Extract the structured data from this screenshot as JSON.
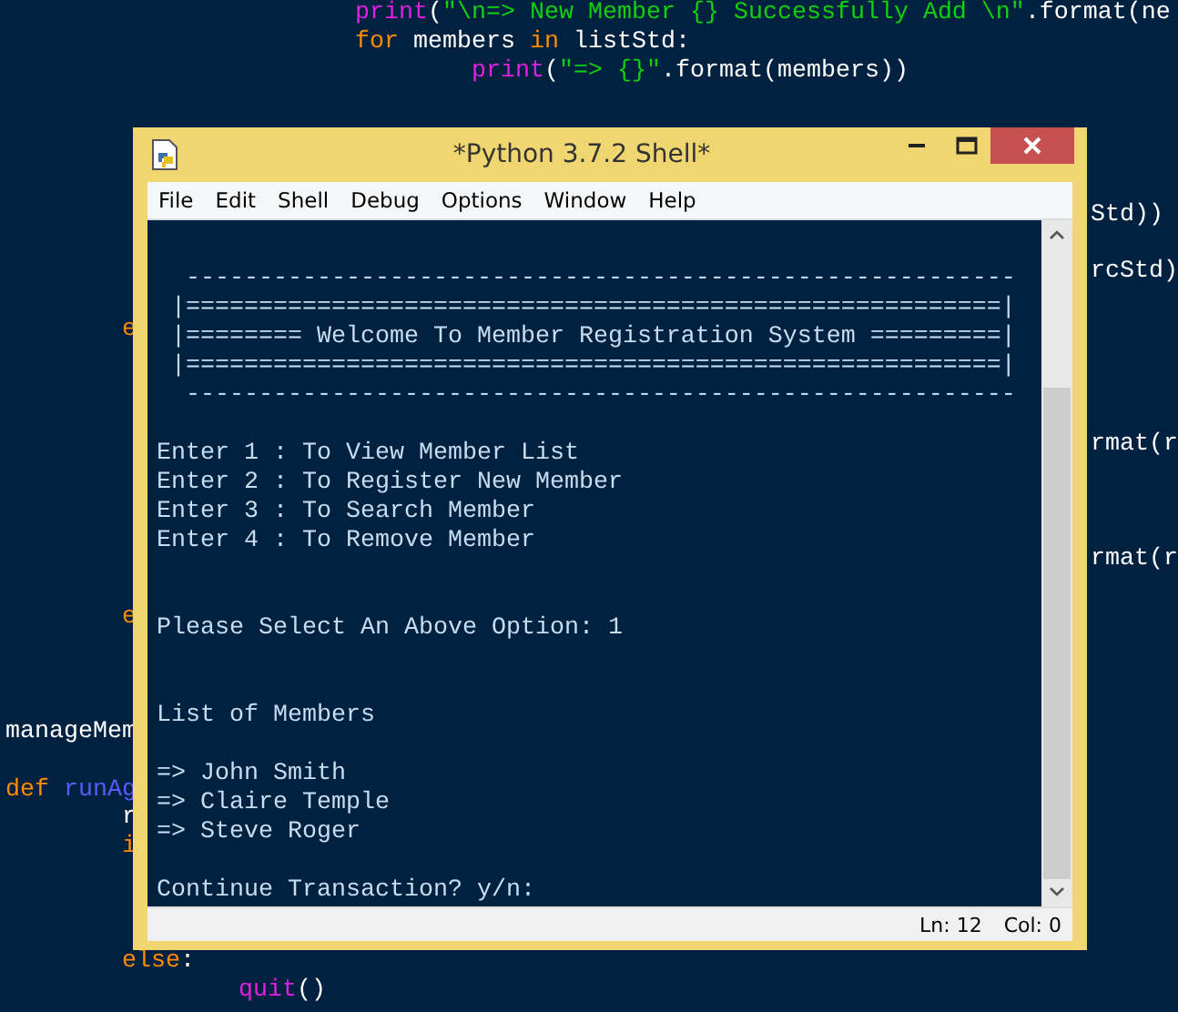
{
  "editor": {
    "lines": [
      {
        "children": [
          {
            "children": [
              {
                "children": [
                  {
                    "kind": "code",
                    "tokens": [
                      {
                        "kind": "builtin",
                        "text": "print"
                      },
                      {
                        "kind": "plain",
                        "text": "("
                      },
                      {
                        "kind": "string",
                        "text": "\"\\n=> New Member {} Successfully Add \\n\""
                      },
                      {
                        "kind": "plain",
                        "text": ".format(ne"
                      }
                    ]
                  },
                  {
                    "kind": "code",
                    "tokens": [
                      {
                        "kind": "keyword",
                        "text": "for"
                      },
                      {
                        "kind": "plain",
                        "text": " members "
                      },
                      {
                        "kind": "keyword",
                        "text": "in"
                      },
                      {
                        "kind": "plain",
                        "text": " listStd:"
                      }
                    ],
                    "children": [
                      {
                        "kind": "code",
                        "tokens": [
                          {
                            "kind": "builtin",
                            "text": "print"
                          },
                          {
                            "kind": "plain",
                            "text": "("
                          },
                          {
                            "kind": "string",
                            "text": "\"=> {}\""
                          },
                          {
                            "kind": "plain",
                            "text": ".format(members))"
                          }
                        ]
                      }
                    ]
                  }
                ]
              }
            ]
          }
        ]
      },
      {
        "kind": "blank"
      },
      {
        "kind": "blank"
      },
      {
        "kind": "blank"
      },
      {
        "kind": "blank"
      },
      {
        "kind": "tail",
        "tokens": [
          {
            "kind": "plain",
            "text": "Std))"
          }
        ]
      },
      {
        "kind": "blank"
      },
      {
        "kind": "tail",
        "tokens": [
          {
            "kind": "plain",
            "text": "rcStd)"
          }
        ]
      },
      {
        "kind": "blank"
      },
      {
        "children": [
          {
            "kind": "code",
            "tokens": [
              {
                "kind": "keyword",
                "text": "e"
              }
            ]
          }
        ]
      },
      {
        "kind": "blank"
      },
      {
        "kind": "blank"
      },
      {
        "kind": "blank"
      },
      {
        "kind": "tail",
        "tokens": [
          {
            "kind": "plain",
            "text": "rmat(r"
          }
        ]
      },
      {
        "kind": "blank"
      },
      {
        "kind": "blank"
      },
      {
        "kind": "blank"
      },
      {
        "kind": "tail",
        "tokens": [
          {
            "kind": "plain",
            "text": "rmat(r"
          }
        ]
      },
      {
        "kind": "blank"
      },
      {
        "children": [
          {
            "kind": "code",
            "tokens": [
              {
                "kind": "keyword",
                "text": "e"
              }
            ]
          }
        ]
      },
      {
        "kind": "blank"
      },
      {
        "kind": "blank"
      },
      {
        "kind": "blank"
      },
      {
        "kind": "code",
        "tokens": [
          {
            "kind": "plain",
            "text": "manageMem"
          }
        ]
      },
      {
        "kind": "blank"
      },
      {
        "kind": "code",
        "tokens": [
          {
            "kind": "keyword",
            "text": "def"
          },
          {
            "kind": "defname",
            "text": " runAg"
          }
        ],
        "children": [
          {
            "kind": "code",
            "tokens": [
              {
                "kind": "plain",
                "text": "r"
              }
            ]
          },
          {
            "kind": "code",
            "tokens": [
              {
                "kind": "keyword",
                "text": "i"
              }
            ]
          },
          {
            "kind": "blank"
          },
          {
            "kind": "blank"
          },
          {
            "kind": "blank"
          },
          {
            "kind": "code",
            "tokens": [
              {
                "kind": "keyword",
                "text": "else"
              },
              {
                "kind": "plain",
                "text": ":"
              }
            ],
            "children": [
              {
                "kind": "code",
                "tokens": [
                  {
                    "kind": "builtin",
                    "text": "quit"
                  },
                  {
                    "kind": "plain",
                    "text": "()"
                  }
                ]
              }
            ]
          }
        ]
      }
    ]
  },
  "window": {
    "title": "*Python 3.7.2 Shell*",
    "menu": [
      "File",
      "Edit",
      "Shell",
      "Debug",
      "Options",
      "Window",
      "Help"
    ],
    "shell_lines": [
      {
        "kind": "blank"
      },
      {
        "kind": "text",
        "text": "  ---------------------------------------------------------"
      },
      {
        "kind": "text",
        "text": " |========================================================|"
      },
      {
        "kind": "text",
        "text": " |======== Welcome To Member Registration System =========|"
      },
      {
        "kind": "text",
        "text": " |========================================================|"
      },
      {
        "kind": "text",
        "text": "  ---------------------------------------------------------"
      },
      {
        "kind": "blank"
      },
      {
        "kind": "text",
        "text": "Enter 1 : To View Member List"
      },
      {
        "kind": "text",
        "text": "Enter 2 : To Register New Member"
      },
      {
        "kind": "text",
        "text": "Enter 3 : To Search Member"
      },
      {
        "kind": "text",
        "text": "Enter 4 : To Remove Member"
      },
      {
        "kind": "blank"
      },
      {
        "kind": "blank"
      },
      {
        "kind": "text",
        "text": "Please Select An Above Option: 1"
      },
      {
        "kind": "blank"
      },
      {
        "kind": "blank"
      },
      {
        "kind": "text",
        "text": "List of Members"
      },
      {
        "kind": "blank"
      },
      {
        "kind": "text",
        "text": "=> John Smith"
      },
      {
        "kind": "text",
        "text": "=> Claire Temple"
      },
      {
        "kind": "text",
        "text": "=> Steve Roger"
      },
      {
        "kind": "blank"
      },
      {
        "kind": "text",
        "text": "Continue Transaction? y/n:"
      }
    ],
    "status": {
      "line": "Ln: 12",
      "col": "Col: 0"
    }
  }
}
